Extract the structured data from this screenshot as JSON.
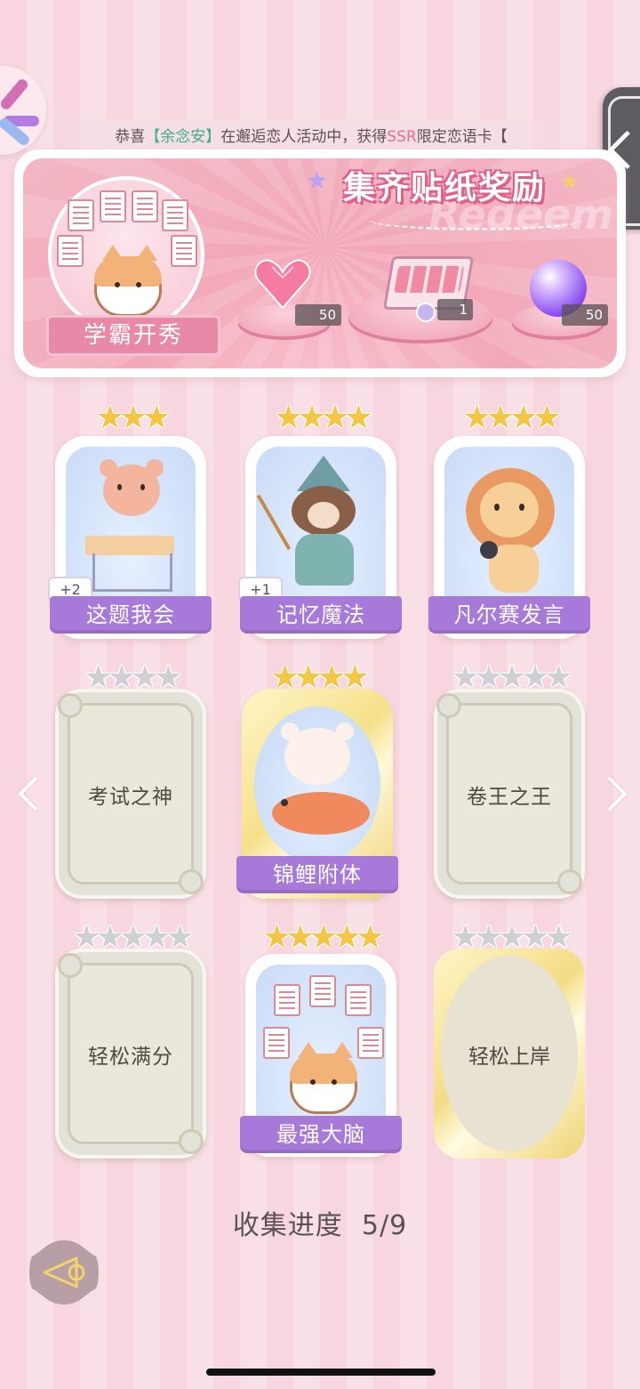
{
  "marquee": {
    "prefix": "恭喜",
    "name": "【余念安】",
    "middle": "在邂逅恋人活动中，获得",
    "rarity": "SSR",
    "suffix": "限定恋语卡【"
  },
  "banner": {
    "title": "集齐贴纸奖励",
    "watermark": "Redeem",
    "badge_label": "学霸开秀",
    "rewards": [
      {
        "item": "pink-heart-gem-icon",
        "count": "50"
      },
      {
        "item": "gift-box-icon",
        "count": "1"
      },
      {
        "item": "purple-orb-icon",
        "count": "50"
      }
    ]
  },
  "stickers": [
    {
      "name": "这题我会",
      "stars": 3,
      "status": "owned",
      "plus": "+2",
      "art": "bear-at-desk"
    },
    {
      "name": "记忆魔法",
      "stars": 4,
      "status": "owned",
      "plus": "+1",
      "art": "otter-wizard"
    },
    {
      "name": "凡尔赛发言",
      "stars": 4,
      "status": "owned",
      "art": "lion-microphone"
    },
    {
      "name": "考试之神",
      "stars": 4,
      "status": "locked"
    },
    {
      "name": "锦鲤附体",
      "stars": 4,
      "status": "owned",
      "art": "bear-with-koi"
    },
    {
      "name": "卷王之王",
      "stars": 5,
      "status": "locked"
    },
    {
      "name": "轻松满分",
      "stars": 5,
      "status": "locked"
    },
    {
      "name": "最强大脑",
      "stars": 5,
      "status": "owned",
      "art": "cat-with-papers"
    },
    {
      "name": "轻松上岸",
      "stars": 5,
      "status": "locked"
    }
  ],
  "progress": {
    "label": "收集进度",
    "value": "5/9",
    "collected": 5,
    "total": 9
  },
  "icons": {
    "left": "chevron-left-icon",
    "right": "chevron-right-icon",
    "back": "back-arrow-icon",
    "side": "side-tab-icon"
  },
  "colors": {
    "label_bar": "#a77ad9",
    "gold_star": "#f5c642",
    "gray_star": "#cfd0d4",
    "background": "#f7d6df"
  }
}
